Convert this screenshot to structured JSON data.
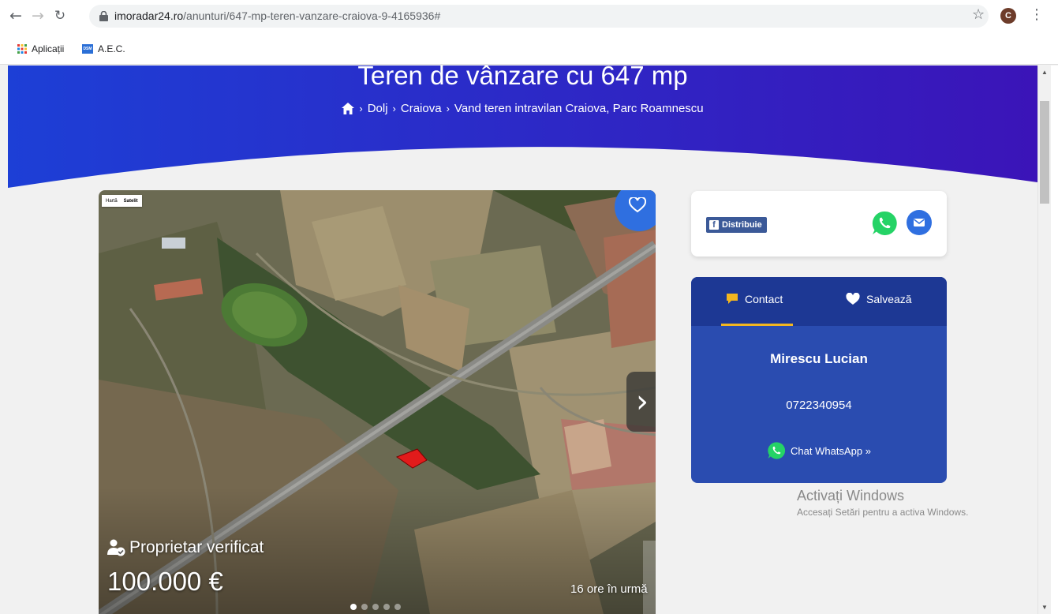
{
  "browser": {
    "url_domain": "imoradar24.ro",
    "url_path": "/anunturi/647-mp-teren-vanzare-craiova-9-4165936#",
    "avatar_letter": "C",
    "bookmarks": [
      {
        "label": "Aplicații",
        "icon": "apps-grid-icon"
      },
      {
        "label": "A.E.C.",
        "icon": "dsm-icon"
      }
    ],
    "bookmark_icon_text": "DSM"
  },
  "hero": {
    "title": "Teren de vânzare cu 647 mp",
    "breadcrumb": [
      "Dolj",
      "Craiova",
      "Vand teren intravilan Craiova, Parc Roamnescu"
    ],
    "separator": "›",
    "gradient_left": "#1d3fd6",
    "gradient_right": "#3b14b8"
  },
  "listing": {
    "verified_label": "Proprietar verificat",
    "price": "100.000 €",
    "posted": "16 ore în urmă",
    "map_type": [
      "Hartă",
      "Satelit"
    ],
    "image_count": 5,
    "active_image": 0
  },
  "share": {
    "fb_label": "Distribuie",
    "fb_letter": "f"
  },
  "contact": {
    "tab_contact": "Contact",
    "tab_save": "Salvează",
    "name": "Mirescu Lucian",
    "phone": "0722340954",
    "chat_label": "Chat WhatsApp »"
  },
  "watermark": {
    "title": "Activați Windows",
    "subtitle": "Accesați Setări pentru a activa Windows."
  },
  "colors": {
    "accent": "#2f6fe0",
    "contact_bg": "#2a4cb0",
    "tab_bg": "#1d3894",
    "underline": "#f3b61f",
    "whatsapp": "#25d366"
  }
}
